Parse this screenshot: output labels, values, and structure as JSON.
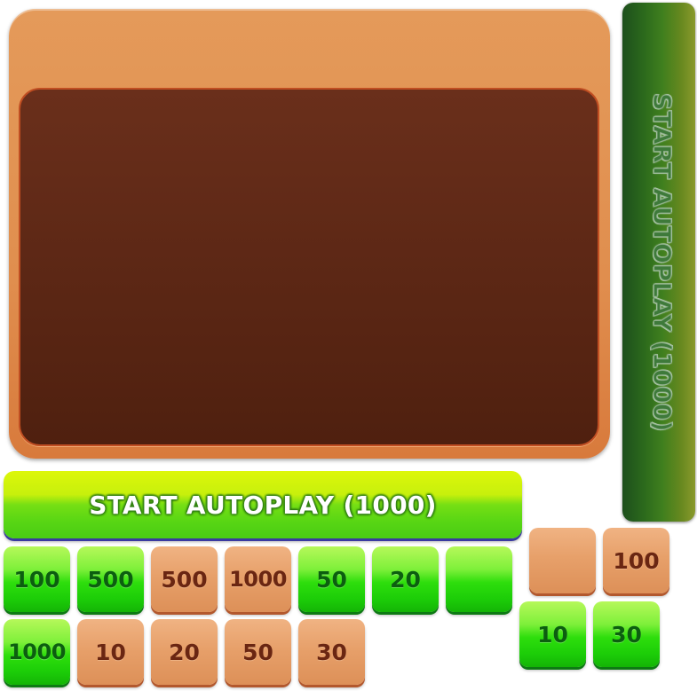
{
  "vertical_button": {
    "label": "START AUTOPLAY (1000)"
  },
  "wide_button": {
    "label": "START AUTOPLAY (1000)"
  },
  "row1": [
    {
      "label": "100",
      "style": "green"
    },
    {
      "label": "500",
      "style": "green"
    },
    {
      "label": "500",
      "style": "orange"
    },
    {
      "label": "1000",
      "style": "orange"
    },
    {
      "label": "50",
      "style": "green"
    },
    {
      "label": "20",
      "style": "green"
    },
    {
      "label": "",
      "style": "green"
    }
  ],
  "row2": [
    {
      "label": "1000",
      "style": "green"
    },
    {
      "label": "10",
      "style": "orange"
    },
    {
      "label": "20",
      "style": "orange"
    },
    {
      "label": "50",
      "style": "orange"
    },
    {
      "label": "30",
      "style": "orange"
    }
  ],
  "right_group": [
    {
      "label": "",
      "style": "orange"
    },
    {
      "label": "100",
      "style": "orange"
    },
    {
      "label": "10",
      "style": "green"
    },
    {
      "label": "30",
      "style": "green"
    }
  ],
  "colors": {
    "green": "#2ede0c",
    "orange": "#e7a06a",
    "panel": "#e08e4e",
    "panel_inner": "#5a2614"
  }
}
